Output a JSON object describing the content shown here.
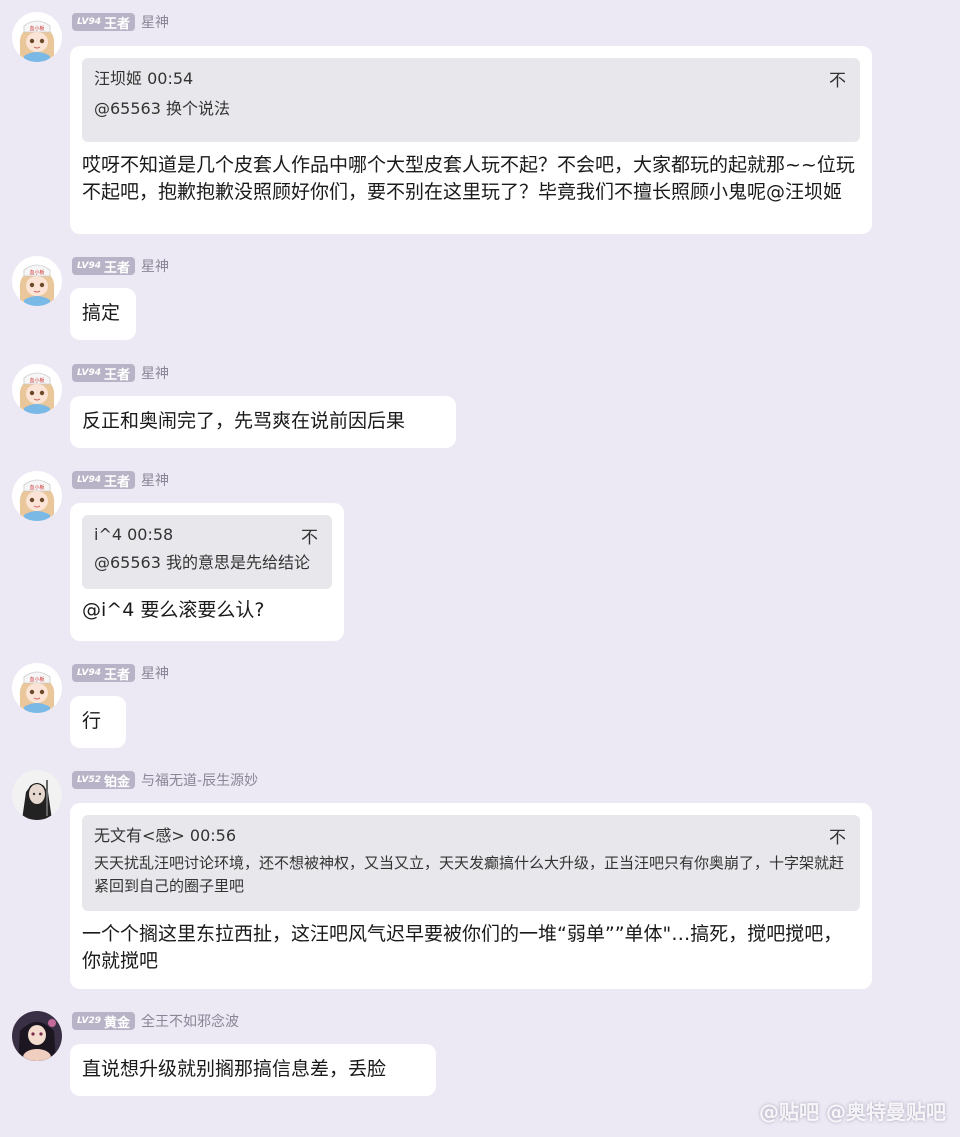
{
  "messages": [
    {
      "level": "LV94",
      "rank": "王者",
      "user": "星神",
      "avatar": "nurse-girl",
      "quote": {
        "header": "汪坝姬 00:54",
        "body": "@65563 换个说法"
      },
      "text": "哎呀不知道是几个皮套人作品中哪个大型皮套人玩不起？不会吧，大家都玩的起就那~~位玩不起吧，抱歉抱歉没照顾好你们，要不别在这里玩了？毕竟我们不擅长照顾小鬼呢@汪坝姬"
    },
    {
      "level": "LV94",
      "rank": "王者",
      "user": "星神",
      "avatar": "nurse-girl",
      "text": "搞定"
    },
    {
      "level": "LV94",
      "rank": "王者",
      "user": "星神",
      "avatar": "nurse-girl",
      "text": "反正和奥闹完了，先骂爽在说前因后果"
    },
    {
      "level": "LV94",
      "rank": "王者",
      "user": "星神",
      "avatar": "nurse-girl",
      "quote": {
        "header": "i^4 00:58",
        "body": "@65563 我的意思是先给结论"
      },
      "text": "@i^4 要么滚要么认?"
    },
    {
      "level": "LV94",
      "rank": "王者",
      "user": "星神",
      "avatar": "nurse-girl",
      "text": "行"
    },
    {
      "level": "LV52",
      "rank": "铂金",
      "user": "与福无道-辰生源妙",
      "avatar": "dark-haired-character",
      "quote": {
        "header": "无文有<感> 00:56",
        "body": "天天扰乱汪吧讨论环境，还不想被神权，又当又立，天天发癫搞什么大升级，正当汪吧只有你奥崩了，十字架就赶紧回到自己的圈子里吧"
      },
      "text": "一个个搁这里东拉西扯，这汪吧风气迟早要被你们的一堆“弱单””单体\"…搞死，搅吧搅吧，你就搅吧"
    },
    {
      "level": "LV29",
      "rank": "黄金",
      "user": "全王不如邪念波",
      "avatar": "dark-anime-girl",
      "text": "直说想升级就别搁那搞信息差，丢脸"
    }
  ],
  "quote_icon": "reply-quote-icon",
  "watermark": "@贴吧 @奥特曼贴吧",
  "colors": {
    "background": "#ece9f4",
    "badge": "#b8b3c6",
    "bubble": "#ffffff",
    "quote": "#e8e8ec"
  }
}
